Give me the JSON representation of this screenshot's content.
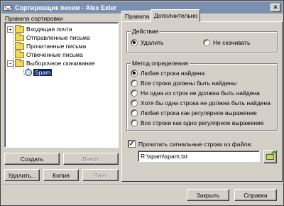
{
  "window": {
    "title": "Сортировщик писем - Alex Exler",
    "close_label": "×"
  },
  "left_panel": {
    "header": "Правила сортировки",
    "tree": [
      {
        "label": "Входящая почта",
        "expander": "+",
        "icon": "folder-icon"
      },
      {
        "label": "Отправленные письма",
        "icon": "folder-icon"
      },
      {
        "label": "Прочитанные письма",
        "icon": "folder-icon"
      },
      {
        "label": "Отвеченные письма",
        "icon": "folder-icon"
      },
      {
        "label": "Выборочное скачивание",
        "expander": "−",
        "icon": "folder-icon"
      },
      {
        "label": "Spam",
        "icon": "spam-rule-icon",
        "selected": true
      }
    ],
    "buttons": {
      "create": "Создать",
      "up": "Вверх",
      "delete": "Удалить...",
      "copy": "Копия",
      "down": "Вниз"
    }
  },
  "tabs": [
    {
      "label": "Правила",
      "active": false
    },
    {
      "label": "Дополнительно",
      "active": true
    }
  ],
  "action_group": {
    "title": "Действие",
    "options": [
      {
        "label": "Удалить",
        "checked": true
      },
      {
        "label": "Не скачивать",
        "checked": false
      }
    ]
  },
  "method_group": {
    "title": "Метод определения",
    "options": [
      {
        "label": "Любая строка найдена",
        "checked": true
      },
      {
        "label": "Все строки должны быть найдены",
        "checked": false
      },
      {
        "label": "Ни одна из строк не должна быть найдена",
        "checked": false
      },
      {
        "label": "Хотя бы одна строка не должна быть найдена",
        "checked": false
      },
      {
        "label": "Любая строка как регулярное выражение",
        "checked": false
      },
      {
        "label": "Все строки как одно регулярное выражение",
        "checked": false
      }
    ]
  },
  "file_option": {
    "label": "Прочитать сигнальные строки из файла:",
    "checked": true,
    "check_mark": "✓",
    "path": "R:\\spam\\spam.txt"
  },
  "footer": {
    "close": "Закрыть",
    "help": "Справка"
  }
}
